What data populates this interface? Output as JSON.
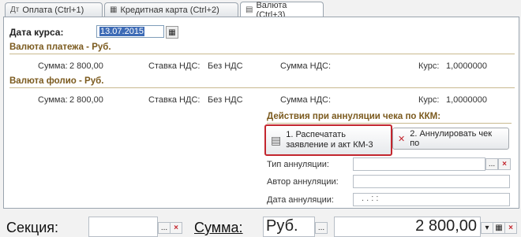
{
  "tabs": [
    {
      "icon": "Дт",
      "label": "Оплата (Ctrl+1)"
    },
    {
      "icon": "▦",
      "label": "Кредитная карта (Ctrl+2)"
    },
    {
      "icon": "▤",
      "label": "Валюта (Ctrl+3)"
    }
  ],
  "rate_date": {
    "label": "Дата курса:",
    "value": "13.07.2015"
  },
  "payment_currency": {
    "title": "Валюта платежа - Руб.",
    "sum_label": "Сумма:",
    "sum_value": "2 800,00",
    "vat_rate_label": "Ставка НДС:",
    "vat_rate_value": "Без НДС",
    "vat_sum_label": "Сумма НДС:",
    "rate_label": "Курс:",
    "rate_value": "1,0000000"
  },
  "folio_currency": {
    "title": "Валюта фолио - Руб.",
    "sum_label": "Сумма:",
    "sum_value": "2 800,00",
    "vat_rate_label": "Ставка НДС:",
    "vat_rate_value": "Без НДС",
    "vat_sum_label": "Сумма НДС:",
    "rate_label": "Курс:",
    "rate_value": "1,0000000"
  },
  "annul": {
    "title": "Действия при аннуляции чека по ККМ:",
    "print_button": {
      "line1": "1. Распечатать",
      "line2": "заявление и акт КМ-3"
    },
    "annul_button": "2. Аннулировать чек по",
    "type_label": "Тип аннуляции:",
    "author_label": "Автор аннуляции:",
    "date_label": "Дата аннуляции:",
    "date_placeholder": ".  .        :  :"
  },
  "footer": {
    "section_label": "Секция:",
    "sum_label": "Сумма:",
    "currency_value": "Руб.",
    "amount_value": "2 800,00"
  },
  "icons": {
    "ellipsis": "...",
    "clear": "×",
    "dropdown": "▾"
  }
}
